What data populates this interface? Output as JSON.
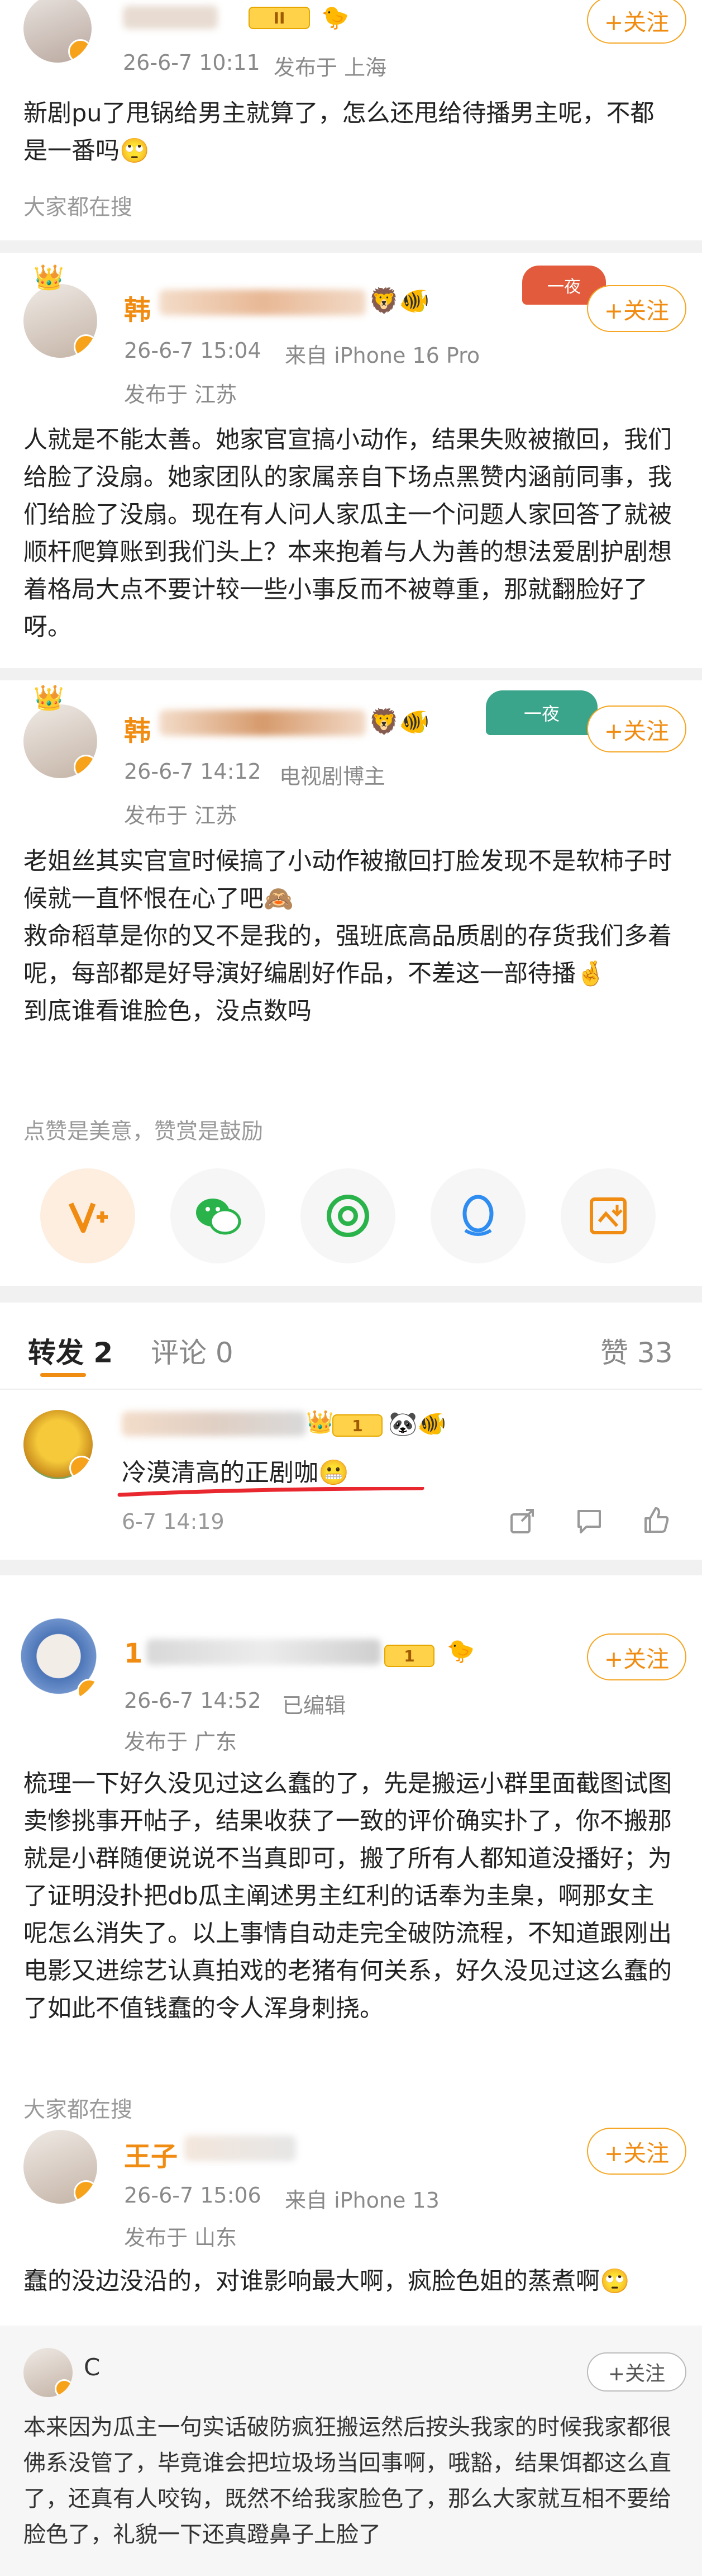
{
  "colors": {
    "accent": "#f08c12",
    "vip": "#f7a21b",
    "underline": "#e8282e"
  },
  "posts": [
    {
      "time": "26-6-7 10:11",
      "source": "发布于 上海",
      "follow": "+关注",
      "level": "II",
      "text": "新剧pu了甩锅给男主就算了，怎么还甩给待播男主呢，不都是一番吗🙄",
      "hint": "大家都在搜"
    },
    {
      "name": "韩",
      "time": "26-6-7 15:04",
      "device": "来自 iPhone 16 Pro",
      "location": "发布于 江苏",
      "follow": "+关注",
      "tag": "一夜",
      "text": "人就是不能太善。她家官宣搞小动作，结果失败被撤回，我们给脸了没扇。她家团队的家属亲自下场点黑赞内涵前同事，我们给脸了没扇。现在有人问人家瓜主一个问题人家回答了就被顺杆爬算账到我们头上？本来抱着与人为善的想法爱剧护剧想着格局大点不要计较一些小事反而不被尊重，那就翻脸好了呀。"
    },
    {
      "name": "韩",
      "time": "26-6-7 14:12",
      "device": "电视剧博主",
      "location": "发布于 江苏",
      "follow": "+关注",
      "tag": "一夜",
      "text": "老姐丝其实官宣时候搞了小动作被撤回打脸发现不是软柿子时候就一直怀恨在心了吧🙈\n救命稻草是你的又不是我的，强班底高品质剧的存货我们多着呢，每部都是好导演好编剧好作品，不差这一部待播🤞\n到底谁看谁脸色，没点数吗",
      "reward_hint": "点赞是美意，赞赏是鼓励"
    }
  ],
  "tabs": {
    "repost": "转发 2",
    "comment": "评论 0",
    "like": "赞 33"
  },
  "repost": {
    "level": "1",
    "text": "冷漠清高的正剧咖😬",
    "time": "6-7 14:19"
  },
  "post4": {
    "name": "1",
    "time": "26-6-7 14:52",
    "edited": "已编辑",
    "location": "发布于 广东",
    "follow": "+关注",
    "level": "1",
    "text": "梳理一下好久没见过这么蠢的了，先是搬运小群里面截图试图卖惨挑事开帖子，结果收获了一致的评价确实扑了，你不搬那就是小群随便说说不当真即可，搬了所有人都知道没播好；为了证明没扑把db瓜主阐述男主红利的话奉为圭臬，啊那女主呢怎么消失了。以上事情自动走完全破防流程，不知道跟刚出电影又进综艺认真拍戏的老猪有何关系，好久没见过这么蠢的了如此不值钱蠢的令人浑身刺挠。",
    "hint": "大家都在搜"
  },
  "post5": {
    "name": "王子",
    "time": "26-6-7 15:06",
    "device": "来自 iPhone 13",
    "location": "发布于 山东",
    "follow": "+关注",
    "text": "蠢的没边没沿的，对谁影响最大啊，疯脸色姐的蒸煮啊🙄"
  },
  "post6": {
    "name": "C",
    "follow": "+关注",
    "text": "本来因为瓜主一句实话破防疯狂搬运然后按头我家的时候我家都很佛系没管了，毕竟谁会把垃圾场当回事啊，哦豁，结果饵都这么直了，还真有人咬钩，既然不给我家脸色了，那么大家就互相不要给脸色了，礼貌一下还真蹬鼻子上脸了"
  }
}
